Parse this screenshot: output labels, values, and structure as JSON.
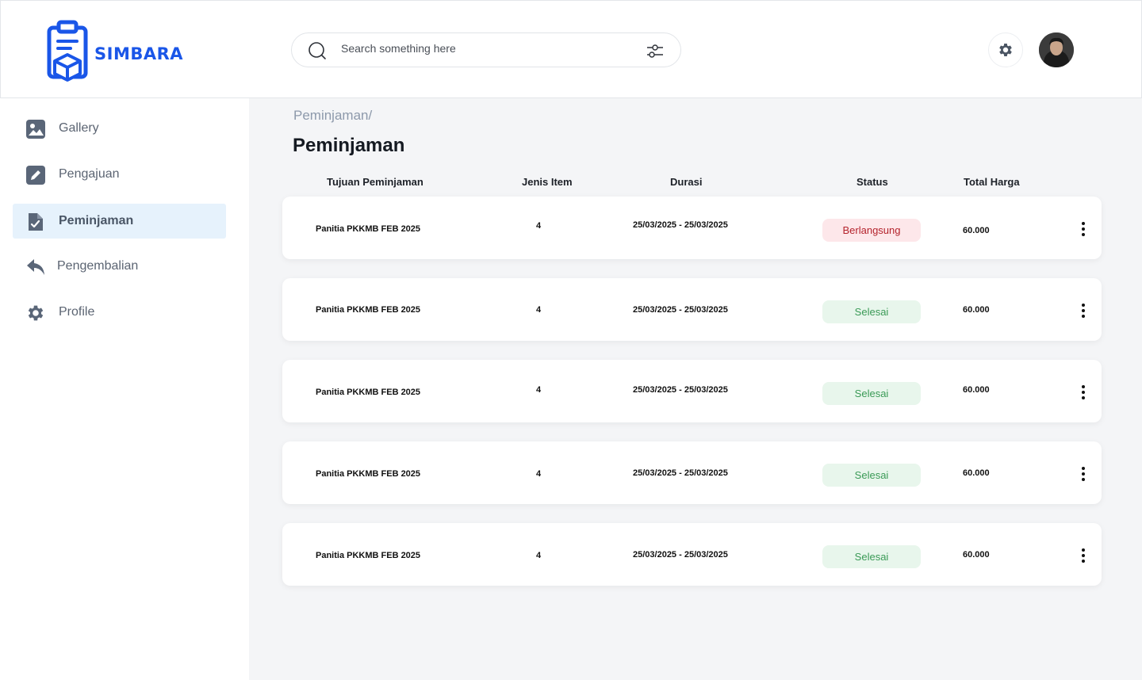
{
  "app": {
    "name": "SIMBARA"
  },
  "search": {
    "placeholder": "Search something here"
  },
  "sidebar": {
    "items": [
      {
        "label": "Gallery",
        "icon": "image-icon",
        "active": false
      },
      {
        "label": "Pengajuan",
        "icon": "edit-icon",
        "active": false
      },
      {
        "label": "Peminjaman",
        "icon": "document-check-icon",
        "active": true
      },
      {
        "label": "Pengembalian",
        "icon": "reply-arrow-icon",
        "active": false
      },
      {
        "label": "Profile",
        "icon": "gear-icon",
        "active": false
      }
    ]
  },
  "main": {
    "breadcrumb": "Peminjaman/",
    "title": "Peminjaman",
    "columns": [
      "Tujuan Peminjaman",
      "Jenis Item",
      "Durasi",
      "Status",
      "Total Harga"
    ],
    "rows": [
      {
        "tujuan": "Panitia PKKMB FEB 2025",
        "jenis": "4",
        "durasi": "25/03/2025 - 25/03/2025",
        "status": "Berlangsung",
        "harga": "60.000"
      },
      {
        "tujuan": "Panitia PKKMB FEB 2025",
        "jenis": "4",
        "durasi": "25/03/2025 - 25/03/2025",
        "status": "Selesai",
        "harga": "60.000"
      },
      {
        "tujuan": "Panitia PKKMB FEB 2025",
        "jenis": "4",
        "durasi": "25/03/2025 - 25/03/2025",
        "status": "Selesai",
        "harga": "60.000"
      },
      {
        "tujuan": "Panitia PKKMB FEB 2025",
        "jenis": "4",
        "durasi": "25/03/2025 - 25/03/2025",
        "status": "Selesai",
        "harga": "60.000"
      },
      {
        "tujuan": "Panitia PKKMB FEB 2025",
        "jenis": "4",
        "durasi": "25/03/2025 - 25/03/2025",
        "status": "Selesai",
        "harga": "60.000"
      }
    ]
  },
  "colors": {
    "brand": "#1a56e8",
    "active_nav_bg": "#e6f2fc",
    "status_ongoing_bg": "#fde7ea",
    "status_ongoing_text": "#b4232c",
    "status_done_bg": "#e8f6ec",
    "status_done_text": "#3a9a56"
  }
}
